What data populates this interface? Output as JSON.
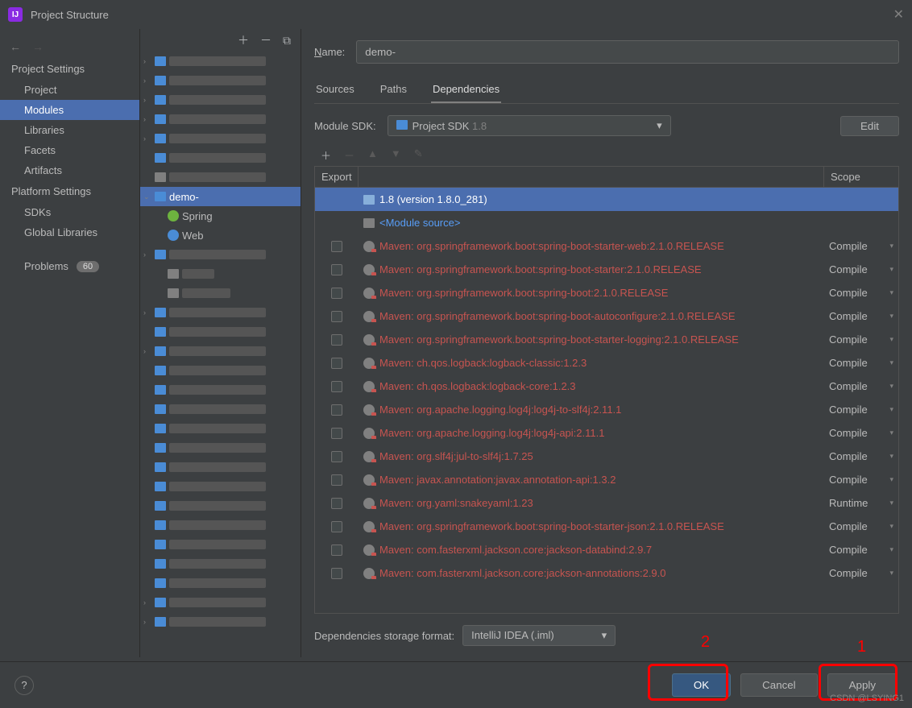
{
  "window": {
    "title": "Project Structure"
  },
  "nav": {
    "section_project": "Project Settings",
    "items_project": [
      "Project",
      "Modules",
      "Libraries",
      "Facets",
      "Artifacts"
    ],
    "section_platform": "Platform Settings",
    "items_platform": [
      "SDKs",
      "Global Libraries"
    ],
    "problems_label": "Problems",
    "problems_count": "60"
  },
  "tree": {
    "selected_label": "demo-",
    "facet_spring": "Spring",
    "facet_web": "Web"
  },
  "form": {
    "name_label": "Name:",
    "name_value": "demo-",
    "tabs": [
      "Sources",
      "Paths",
      "Dependencies"
    ],
    "module_sdk_label": "Module SDK:",
    "module_sdk_value": "Project SDK",
    "module_sdk_version": "1.8",
    "edit_label": "Edit",
    "col_export": "Export",
    "col_scope": "Scope",
    "storage_label": "Dependencies storage format:",
    "storage_value": "IntelliJ IDEA (.iml)"
  },
  "deps": [
    {
      "type": "sdk",
      "name": "1.8 (version 1.8.0_281)",
      "scope": "",
      "chk": false
    },
    {
      "type": "module",
      "name": "<Module source>",
      "scope": "",
      "chk": false
    },
    {
      "type": "maven",
      "name": "Maven: org.springframework.boot:spring-boot-starter-web:2.1.0.RELEASE",
      "scope": "Compile",
      "chk": true
    },
    {
      "type": "maven",
      "name": "Maven: org.springframework.boot:spring-boot-starter:2.1.0.RELEASE",
      "scope": "Compile",
      "chk": true
    },
    {
      "type": "maven",
      "name": "Maven: org.springframework.boot:spring-boot:2.1.0.RELEASE",
      "scope": "Compile",
      "chk": true
    },
    {
      "type": "maven",
      "name": "Maven: org.springframework.boot:spring-boot-autoconfigure:2.1.0.RELEASE",
      "scope": "Compile",
      "chk": true
    },
    {
      "type": "maven",
      "name": "Maven: org.springframework.boot:spring-boot-starter-logging:2.1.0.RELEASE",
      "scope": "Compile",
      "chk": true
    },
    {
      "type": "maven",
      "name": "Maven: ch.qos.logback:logback-classic:1.2.3",
      "scope": "Compile",
      "chk": true
    },
    {
      "type": "maven",
      "name": "Maven: ch.qos.logback:logback-core:1.2.3",
      "scope": "Compile",
      "chk": true
    },
    {
      "type": "maven",
      "name": "Maven: org.apache.logging.log4j:log4j-to-slf4j:2.11.1",
      "scope": "Compile",
      "chk": true
    },
    {
      "type": "maven",
      "name": "Maven: org.apache.logging.log4j:log4j-api:2.11.1",
      "scope": "Compile",
      "chk": true
    },
    {
      "type": "maven",
      "name": "Maven: org.slf4j:jul-to-slf4j:1.7.25",
      "scope": "Compile",
      "chk": true
    },
    {
      "type": "maven",
      "name": "Maven: javax.annotation:javax.annotation-api:1.3.2",
      "scope": "Compile",
      "chk": true
    },
    {
      "type": "maven",
      "name": "Maven: org.yaml:snakeyaml:1.23",
      "scope": "Runtime",
      "chk": true
    },
    {
      "type": "maven",
      "name": "Maven: org.springframework.boot:spring-boot-starter-json:2.1.0.RELEASE",
      "scope": "Compile",
      "chk": true
    },
    {
      "type": "maven",
      "name": "Maven: com.fasterxml.jackson.core:jackson-databind:2.9.7",
      "scope": "Compile",
      "chk": true
    },
    {
      "type": "maven",
      "name": "Maven: com.fasterxml.jackson.core:jackson-annotations:2.9.0",
      "scope": "Compile",
      "chk": true
    }
  ],
  "footer": {
    "ok": "OK",
    "cancel": "Cancel",
    "apply": "Apply"
  },
  "annotations": {
    "one": "1",
    "two": "2"
  },
  "watermark": "CSDN @LSYING1"
}
